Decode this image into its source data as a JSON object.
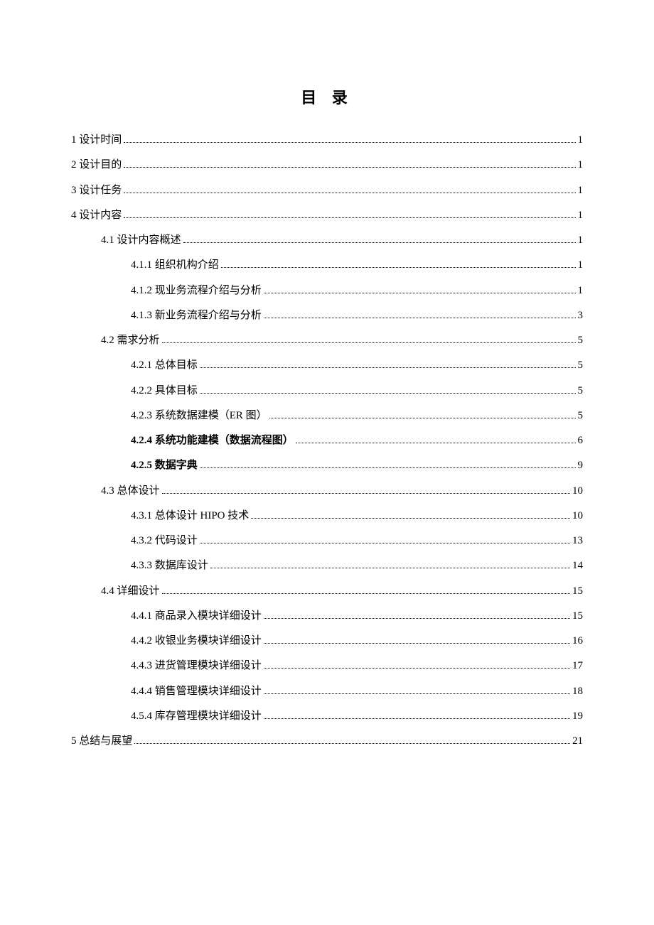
{
  "title": "目 录",
  "entries": [
    {
      "label": "1 设计时间",
      "page": "1",
      "level": 1,
      "bold": false
    },
    {
      "label": "2 设计目的",
      "page": "1",
      "level": 1,
      "bold": false
    },
    {
      "label": "3 设计任务",
      "page": "1",
      "level": 1,
      "bold": false
    },
    {
      "label": "4 设计内容",
      "page": "1",
      "level": 1,
      "bold": false
    },
    {
      "label": "4.1 设计内容概述",
      "page": "1",
      "level": 2,
      "bold": false
    },
    {
      "label": "4.1.1 组织机构介绍",
      "page": "1",
      "level": 3,
      "bold": false
    },
    {
      "label": "4.1.2 现业务流程介绍与分析",
      "page": "1",
      "level": 3,
      "bold": false
    },
    {
      "label": "4.1.3 新业务流程介绍与分析",
      "page": "3",
      "level": 3,
      "bold": false
    },
    {
      "label": "4.2 需求分析",
      "page": "5",
      "level": 2,
      "bold": false
    },
    {
      "label": "4.2.1 总体目标",
      "page": "5",
      "level": 3,
      "bold": false
    },
    {
      "label": "4.2.2 具体目标",
      "page": "5",
      "level": 3,
      "bold": false
    },
    {
      "label": "4.2.3 系统数据建模（ER 图）",
      "page": "5",
      "level": 3,
      "bold": false
    },
    {
      "label": "4.2.4 系统功能建模（数据流程图）",
      "page": "6",
      "level": 3,
      "bold": true
    },
    {
      "label": "4.2.5 数据字典",
      "page": "9",
      "level": 3,
      "bold": true
    },
    {
      "label": "4.3 总体设计",
      "page": "10",
      "level": 2,
      "bold": false
    },
    {
      "label": "4.3.1 总体设计 HIPO 技术",
      "page": "10",
      "level": 3,
      "bold": false
    },
    {
      "label": "4.3.2 代码设计",
      "page": "13",
      "level": 3,
      "bold": false
    },
    {
      "label": "4.3.3 数据库设计",
      "page": "14",
      "level": 3,
      "bold": false
    },
    {
      "label": "4.4 详细设计",
      "page": "15",
      "level": 2,
      "bold": false
    },
    {
      "label": "4.4.1 商品录入模块详细设计",
      "page": "15",
      "level": 3,
      "bold": false
    },
    {
      "label": "4.4.2 收银业务模块详细设计",
      "page": "16",
      "level": 3,
      "bold": false
    },
    {
      "label": "4.4.3 进货管理模块详细设计",
      "page": "17",
      "level": 3,
      "bold": false
    },
    {
      "label": "4.4.4 销售管理模块详细设计",
      "page": "18",
      "level": 3,
      "bold": false
    },
    {
      "label": "4.5.4 库存管理模块详细设计",
      "page": "19",
      "level": 3,
      "bold": false
    },
    {
      "label": "5 总结与展望",
      "page": "21",
      "level": 1,
      "bold": false
    }
  ]
}
